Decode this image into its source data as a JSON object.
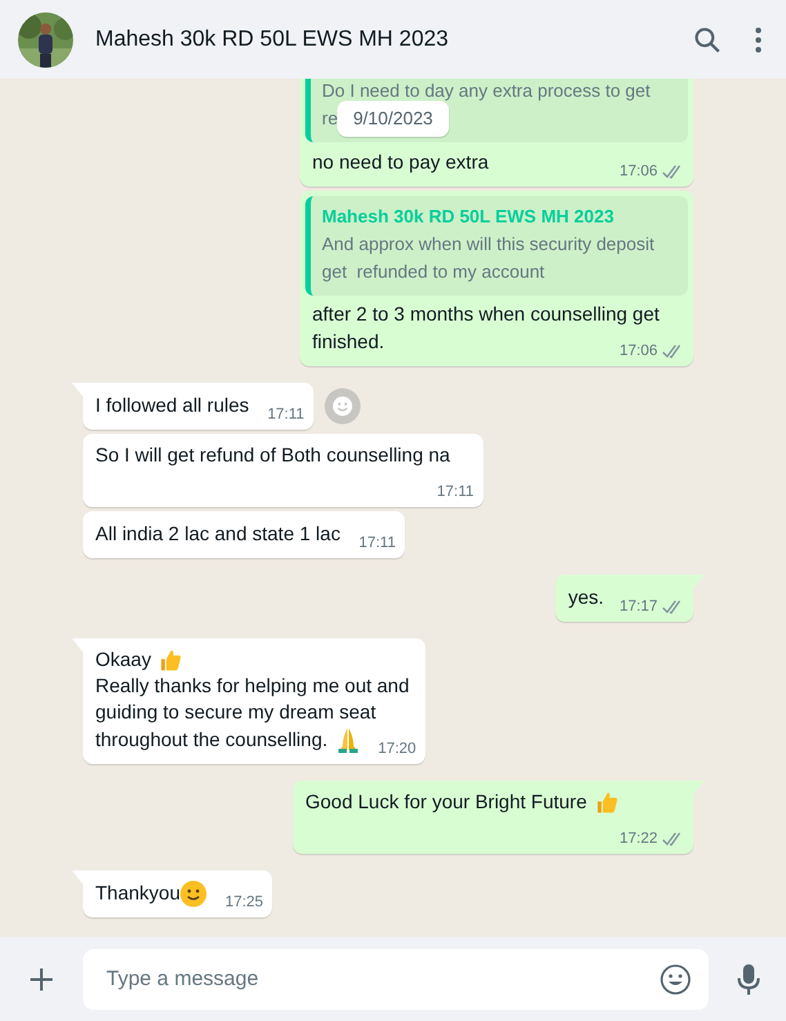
{
  "header": {
    "title": "Mahesh 30k RD 50L EWS MH 2023"
  },
  "date_pill": "9/10/2023",
  "messages": [
    {
      "kind": "outgoing",
      "tail": false,
      "quote": {
        "lines": [
          "Do I need to day any extra process to get",
          "re"
        ]
      },
      "lines": [
        {
          "kind": "plain",
          "text": "no need to pay extra"
        }
      ],
      "time": "17:06",
      "read": false
    },
    {
      "kind": "outgoing",
      "tail": false,
      "quote": {
        "sender": "Mahesh 30k RD 50L EWS MH 2023",
        "lines": [
          "And approx when will this security deposit",
          "get  refunded to my account"
        ]
      },
      "lines": [
        {
          "kind": "plain",
          "text": "after 2 to 3 months when counselling get"
        },
        {
          "kind": "plain",
          "text": "finished."
        }
      ],
      "time": "17:06",
      "read": false
    },
    {
      "kind": "incoming",
      "tail": true,
      "react": true,
      "lines": [
        {
          "kind": "plain",
          "text": "I followed all rules"
        }
      ],
      "time": "17:11"
    },
    {
      "kind": "incoming",
      "tail": false,
      "react": false,
      "lines": [
        {
          "kind": "plain",
          "text": "So I will get refund of Both counselling na"
        }
      ],
      "time": "17:11"
    },
    {
      "kind": "incoming",
      "tail": false,
      "react": false,
      "lines": [
        {
          "kind": "plain",
          "text": "All india 2 lac and state 1 lac"
        }
      ],
      "time": "17:11"
    },
    {
      "kind": "outgoing",
      "tail": true,
      "lines": [
        {
          "kind": "plain",
          "text": "yes."
        }
      ],
      "time": "17:17",
      "read": false
    },
    {
      "kind": "incoming",
      "tail": true,
      "react": false,
      "lines": [
        {
          "kind": "thumb",
          "text": "Okaay"
        },
        {
          "kind": "plain",
          "text": "Really thanks for helping me out and"
        },
        {
          "kind": "plain",
          "text": "guiding to secure my dream seat"
        },
        {
          "kind": "pray",
          "text": "throughout the counselling."
        }
      ],
      "time": "17:20"
    },
    {
      "kind": "outgoing",
      "tail": true,
      "lines": [
        {
          "kind": "thumb",
          "text": "Good Luck for your Bright Future"
        }
      ],
      "time": "17:22",
      "read": false
    },
    {
      "kind": "incoming",
      "tail": true,
      "react": false,
      "lines": [
        {
          "kind": "smile",
          "text": "Thankyou"
        }
      ],
      "time": "17:25"
    }
  ],
  "composer": {
    "placeholder": "Type a message"
  }
}
